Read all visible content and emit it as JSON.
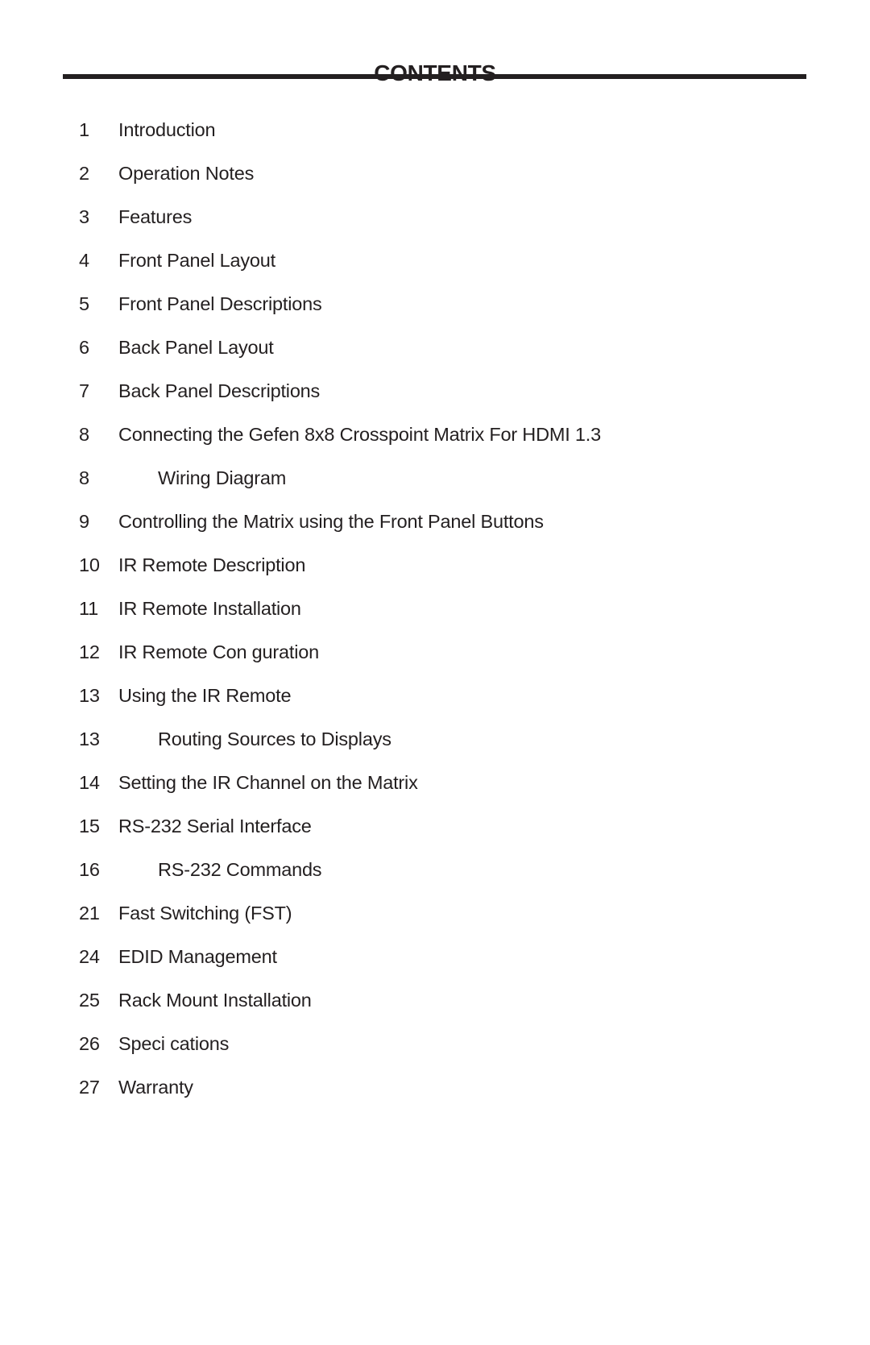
{
  "page": {
    "title": "CONTENTS",
    "text_color": "#231f20",
    "rule_color": "#231f20"
  },
  "toc": {
    "entries": [
      {
        "page": "1",
        "label": "Introduction",
        "level": 1
      },
      {
        "page": "2",
        "label": "Operation Notes",
        "level": 1
      },
      {
        "page": "3",
        "label": "Features",
        "level": 1
      },
      {
        "page": "4",
        "label": "Front Panel Layout",
        "level": 1
      },
      {
        "page": "5",
        "label": "Front Panel Descriptions",
        "level": 1
      },
      {
        "page": "6",
        "label": "Back Panel Layout",
        "level": 1
      },
      {
        "page": "7",
        "label": "Back Panel Descriptions",
        "level": 1
      },
      {
        "page": "8",
        "label": "Connecting the Gefen 8x8 Crosspoint Matrix For HDMI 1.3",
        "level": 1
      },
      {
        "page": "8",
        "label": "Wiring Diagram",
        "level": 2
      },
      {
        "page": "9",
        "label": "Controlling the Matrix using the Front Panel Buttons",
        "level": 1
      },
      {
        "page": "10",
        "label": "IR Remote Description",
        "level": 1
      },
      {
        "page": "11",
        "label": "IR Remote Installation",
        "level": 1
      },
      {
        "page": "12",
        "label": "IR Remote Con guration",
        "level": 1
      },
      {
        "page": "13",
        "label": "Using the IR Remote",
        "level": 1
      },
      {
        "page": "13",
        "label": "Routing Sources to Displays",
        "level": 2
      },
      {
        "page": "14",
        "label": "Setting the IR Channel on the Matrix",
        "level": 1
      },
      {
        "page": "15",
        "label": "RS-232 Serial Interface",
        "level": 1
      },
      {
        "page": "16",
        "label": "RS-232 Commands",
        "level": 2
      },
      {
        "page": "21",
        "label": "Fast Switching (FST)",
        "level": 1
      },
      {
        "page": "24",
        "label": "EDID Management",
        "level": 1
      },
      {
        "page": "25",
        "label": "Rack Mount Installation",
        "level": 1
      },
      {
        "page": "26",
        "label": "Speci cations",
        "level": 1
      },
      {
        "page": "27",
        "label": "Warranty",
        "level": 1
      }
    ]
  }
}
